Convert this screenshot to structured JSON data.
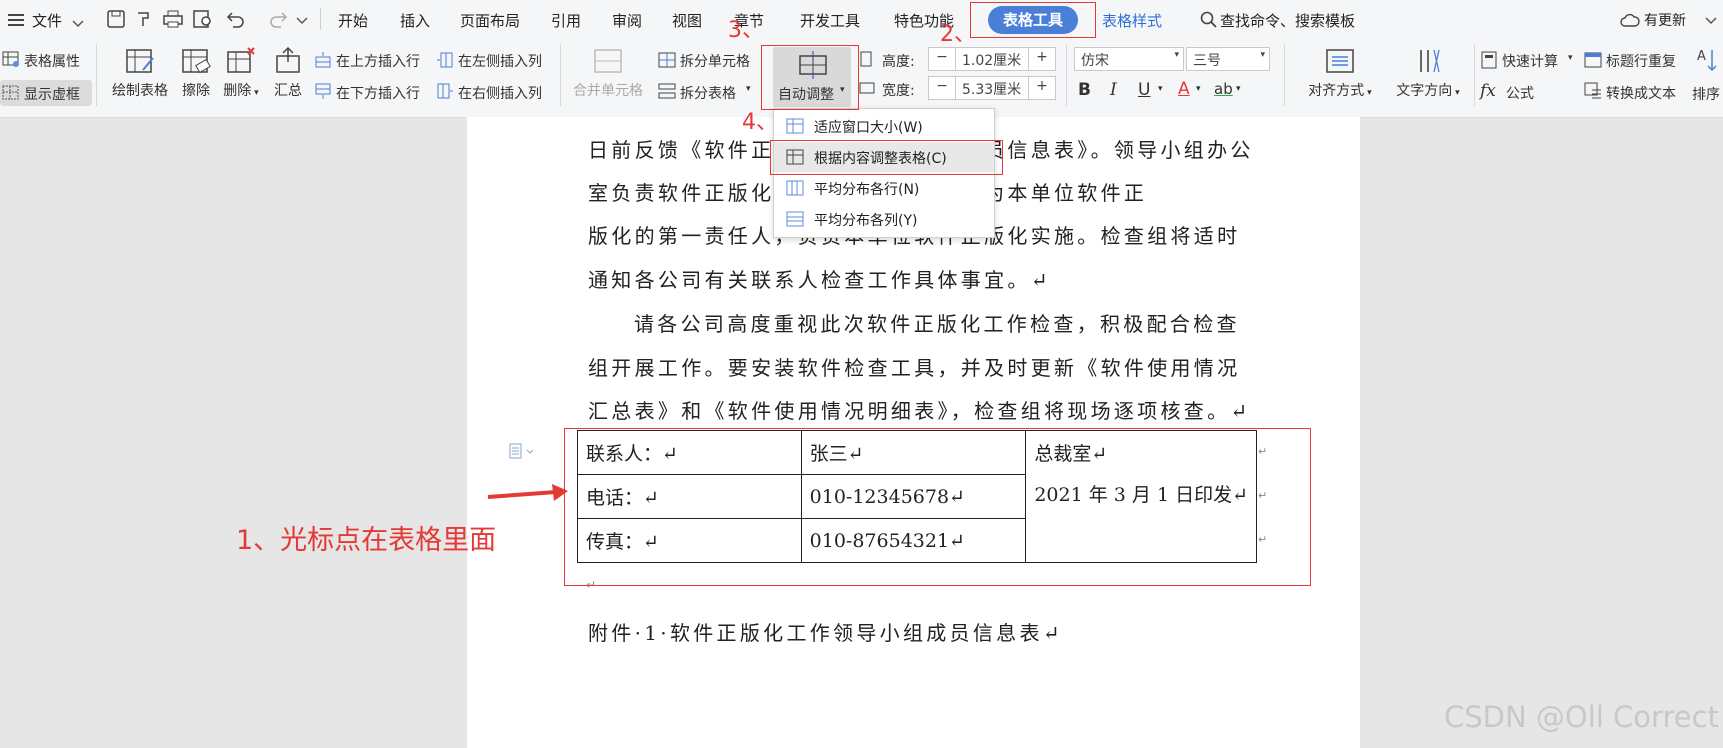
{
  "menubar": {
    "file": "文件",
    "tabs": [
      "开始",
      "插入",
      "页面布局",
      "引用",
      "审阅",
      "视图",
      "章节",
      "开发工具",
      "特色功能"
    ],
    "active_tab": "表格工具",
    "table_style_tab": "表格样式",
    "search": "查找命令、搜索模板",
    "update": "有更新"
  },
  "ribbon": {
    "table_props": "表格属性",
    "show_grid": "显示虚框",
    "draw_table": "绘制表格",
    "erase": "擦除",
    "delete": "删除",
    "summary": "汇总",
    "insert_above": "在上方插入行",
    "insert_below": "在下方插入行",
    "insert_left": "在左侧插入列",
    "insert_right": "在右侧插入列",
    "merge_cells": "合并单元格",
    "split_cells": "拆分单元格",
    "split_table": "拆分表格",
    "auto_adjust": "自动调整",
    "height_label": "高度:",
    "height_value": "1.02厘米",
    "width_label": "宽度:",
    "width_value": "5.33厘米",
    "font_name": "仿宋",
    "font_size": "三号",
    "bold": "B",
    "italic": "I",
    "underline": "U",
    "font_color": "A",
    "highlight": "ab",
    "align": "对齐方式",
    "text_dir": "文字方向",
    "quick_calc": "快速计算",
    "formula": "公式",
    "repeat_header": "标题行重复",
    "convert_text": "转换成文本",
    "sort": "排序"
  },
  "dropdown": {
    "items": [
      "适应窗口大小(W)",
      "根据内容调整表格(C)",
      "平均分布各行(N)",
      "平均分布各列(Y)"
    ]
  },
  "annotations": {
    "step1": "1、光标点在表格里面",
    "step2": "2、",
    "step3": "3、",
    "step4": "4、"
  },
  "document": {
    "lines": [
      "日前反馈《软件正版化工作领导小组成员信息表》。领导小组办公",
      "室负责软件正版化工作，各单位负责人为本单位软件正",
      "版化的第一责任人，负责本单位软件正版化实施。检查组将适时",
      "通知各公司有关联系人检查工作具体事宜。↵",
      "请各公司高度重视此次软件正版化工作检查，积极配合检查",
      "组开展工作。要安装软件检查工具，并及时更新《软件使用情况",
      "汇总表》和《软件使用情况明细表》，检查组将现场逐项核查。↵"
    ],
    "table": {
      "rows": [
        [
          "联系人：↵",
          "张三↵"
        ],
        [
          "电话：↵",
          "010-12345678↵"
        ],
        [
          "传真：↵",
          "010-87654321↵"
        ]
      ],
      "merged_line1": "总裁室↵",
      "merged_line2": "2021 年 3 月 1 日印发↵"
    },
    "after_table_mark": "↵",
    "attachment": "附件·1·软件正版化工作领导小组成员信息表↵"
  },
  "watermark": "CSDN @Oll Correct",
  "colors": {
    "accent": "#4a7fd8",
    "annotation_red": "#e53935"
  }
}
